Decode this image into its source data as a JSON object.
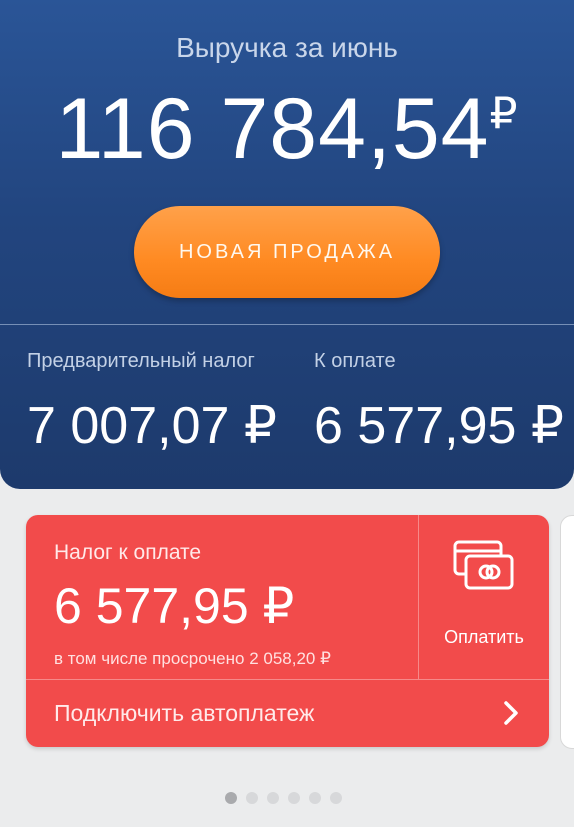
{
  "header": {
    "title": "Выручка за июнь",
    "revenue_amount": "116 784,54",
    "revenue_currency": "₽",
    "new_sale_label": "НОВАЯ ПРОДАЖА"
  },
  "taxes": {
    "preliminary_label": "Предварительный налог",
    "preliminary_value": "7 007,07 ₽",
    "to_pay_label": "К оплате",
    "to_pay_value": "6 577,95 ₽"
  },
  "tax_card": {
    "title": "Налог к оплате",
    "amount": "6 577,95 ₽",
    "overdue_note": "в том числе просрочено 2 058,20 ₽",
    "pay_label": "Оплатить",
    "pay_icon": "card-payment-icon",
    "autopay_label": "Подключить автоплатеж",
    "autopay_icon": "chevron-right-icon",
    "color": "#f24b4b"
  },
  "pager": {
    "total": 6,
    "active_index": 0
  },
  "colors": {
    "hero_blue": "#22457f",
    "accent_orange": "#ff8a22"
  }
}
